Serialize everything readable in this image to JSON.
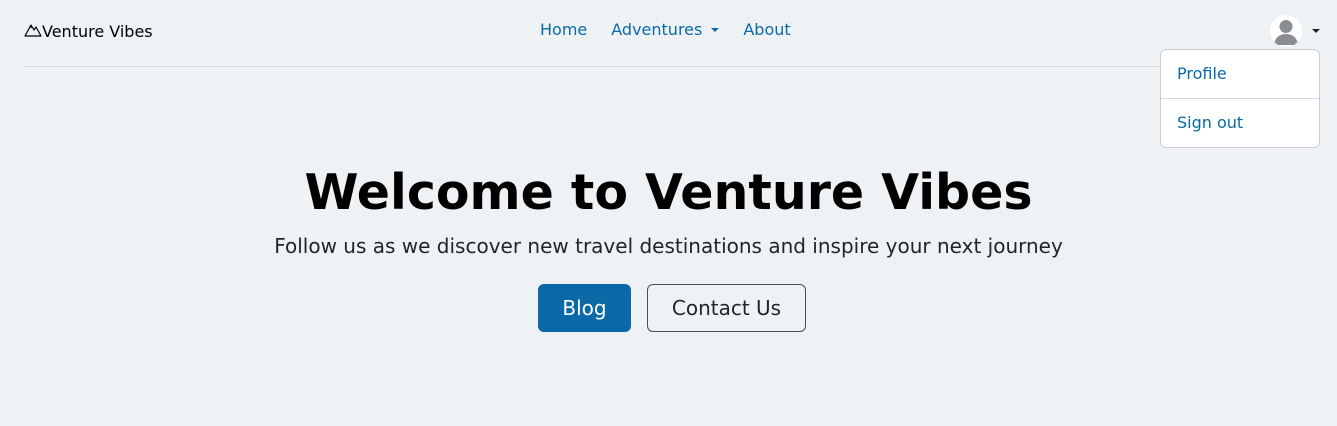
{
  "brand": {
    "name": "Venture Vibes",
    "icon": "mountain-icon"
  },
  "nav": {
    "home": "Home",
    "adventures": "Adventures",
    "about": "About"
  },
  "user_menu": {
    "avatar_icon": "user-avatar-icon",
    "items": [
      "Profile",
      "Sign out"
    ]
  },
  "hero": {
    "title": "Welcome to Venture Vibes",
    "subtitle": "Follow us as we discover new travel destinations and inspire your next journey",
    "primary_button": "Blog",
    "secondary_button": "Contact Us"
  },
  "colors": {
    "background": "#eff2f5",
    "link": "#0a6aa8",
    "primary": "#0a6aa8"
  }
}
